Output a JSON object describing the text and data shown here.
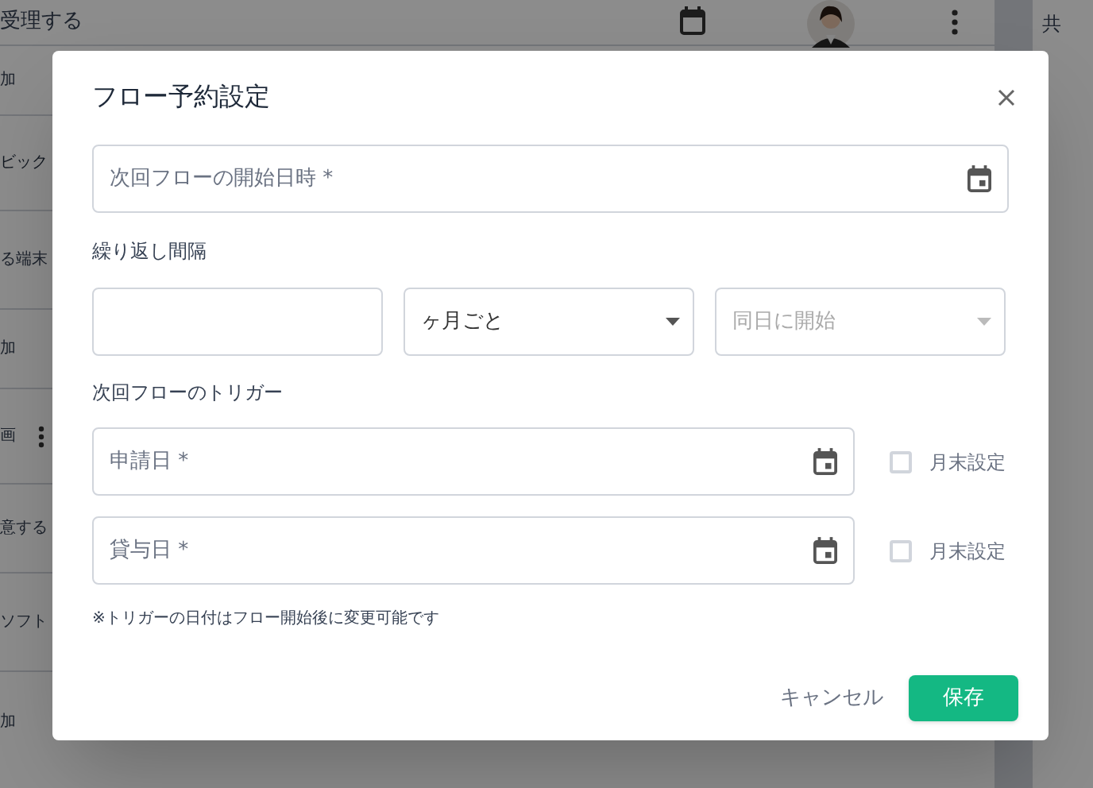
{
  "background": {
    "top_item": "受理する",
    "right_header": "共",
    "side_items": [
      {
        "text": "加"
      },
      {
        "text": "ビック"
      },
      {
        "text": "る端末"
      },
      {
        "text": "加"
      },
      {
        "text": "画"
      },
      {
        "text": "意する"
      },
      {
        "text": "ソフト"
      },
      {
        "text": "加"
      }
    ]
  },
  "dialog": {
    "title": "フロー予約設定",
    "start_field": {
      "placeholder": "次回フローの開始日時 *"
    },
    "interval_label": "繰り返し間隔",
    "interval_fields": [
      {
        "kind": "text"
      },
      {
        "kind": "select",
        "value": "ヶ月ごと",
        "disabled": false
      },
      {
        "kind": "select",
        "value": "同日に開始",
        "disabled": true
      }
    ],
    "trigger_label": "次回フローのトリガー",
    "triggers": [
      {
        "placeholder": "申請日 *",
        "checkbox_label": "月末設定",
        "checked": false
      },
      {
        "placeholder": "貸与日 *",
        "checkbox_label": "月末設定",
        "checked": false
      }
    ],
    "note": "※トリガーの日付はフロー開始後に変更可能です",
    "cancel": "キャンセル",
    "save": "保存"
  }
}
